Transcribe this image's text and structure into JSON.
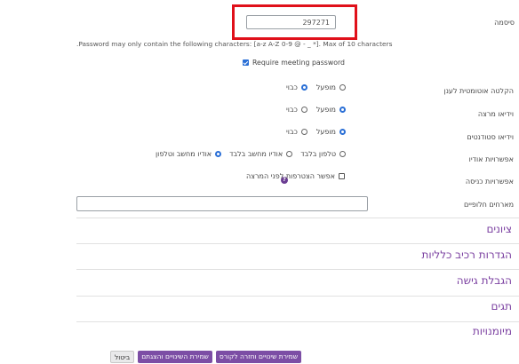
{
  "password": {
    "label": "סיסמה",
    "value": "297271",
    "note": ".Password may only contain the following characters: [a-z A-Z 0-9 @ - _ *]. Max of 10 characters",
    "require_label": "Require meeting password"
  },
  "rows": {
    "auto_record": {
      "label": "הקלטה אוטומטית לענן",
      "on": "מופעל",
      "off": "כבוי"
    },
    "host_video": {
      "label": "וידיאו מרצה",
      "on": "מופעל",
      "off": "כבוי"
    },
    "student_video": {
      "label": "וידיאו סטודנטים",
      "on": "מופעל",
      "off": "כבוי"
    },
    "audio_options": {
      "label": "אפשרויות אודיו",
      "opt_phone_only": "טלפון בלבד",
      "opt_computer_only": "אודיו מחשב בלבד",
      "opt_both": "אודיו מחשב וטלפון"
    },
    "entry_options": {
      "label": "אפשרויות כניסה",
      "join_before": "אפשר הצטרפות לפני המרצה"
    },
    "alt_hosts": {
      "label": "מארחים חלופיים"
    }
  },
  "help_icon_glyph": "?",
  "sections": [
    "ציונים",
    "הגדרות רכיב כלליות",
    "הגבלת גישה",
    "תגים",
    "מיומנויות"
  ],
  "buttons": {
    "save_return": "שמירת שינויים וחזרה לקורס",
    "save_display": "שמירת השינויים והצגתם",
    "cancel": "ביטול"
  }
}
